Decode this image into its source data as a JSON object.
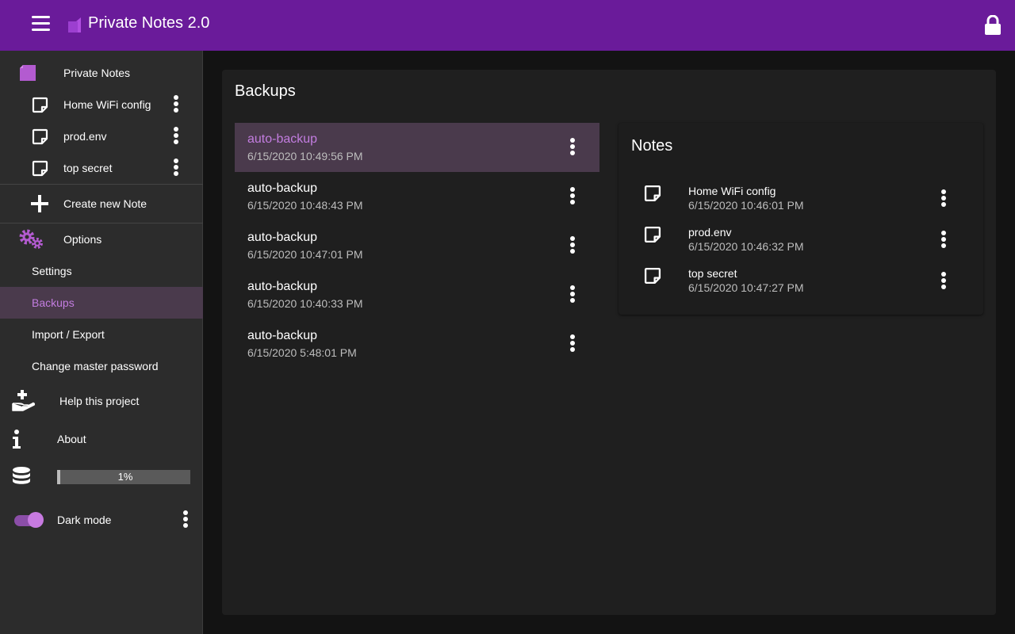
{
  "app": {
    "title": "Private Notes 2.0",
    "accent": "#6a1b9a",
    "highlight": "#c37de0"
  },
  "sidebar": {
    "header_label": "Private Notes",
    "notes": [
      {
        "label": "Home WiFi config"
      },
      {
        "label": "prod.env"
      },
      {
        "label": "top secret"
      }
    ],
    "create_label": "Create new Note",
    "options_label": "Options",
    "settings_label": "Settings",
    "backups_label": "Backups",
    "import_export_label": "Import / Export",
    "change_password_label": "Change master password",
    "help_label": "Help this project",
    "about_label": "About",
    "storage": {
      "percent": 1,
      "text": "1%"
    },
    "dark_mode": {
      "label": "Dark mode",
      "enabled": true
    }
  },
  "main": {
    "title": "Backups",
    "backups": [
      {
        "name": "auto-backup",
        "date": "6/15/2020 10:49:56 PM",
        "selected": true
      },
      {
        "name": "auto-backup",
        "date": "6/15/2020 10:48:43 PM",
        "selected": false
      },
      {
        "name": "auto-backup",
        "date": "6/15/2020 10:47:01 PM",
        "selected": false
      },
      {
        "name": "auto-backup",
        "date": "6/15/2020 10:40:33 PM",
        "selected": false
      },
      {
        "name": "auto-backup",
        "date": "6/15/2020 5:48:01 PM",
        "selected": false
      }
    ],
    "notes_panel": {
      "title": "Notes",
      "notes": [
        {
          "name": "Home WiFi config",
          "date": "6/15/2020 10:46:01 PM"
        },
        {
          "name": "prod.env",
          "date": "6/15/2020 10:46:32 PM"
        },
        {
          "name": "top secret",
          "date": "6/15/2020 10:47:27 PM"
        }
      ]
    }
  }
}
